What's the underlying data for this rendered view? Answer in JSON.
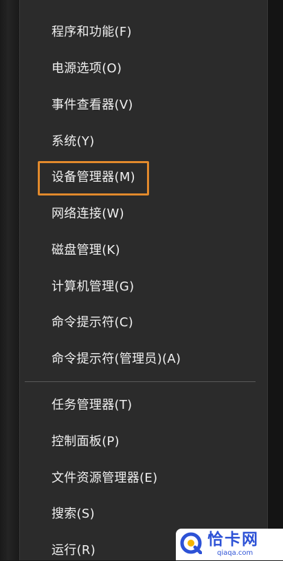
{
  "menu": {
    "items": [
      {
        "label": "程序和功能(F)"
      },
      {
        "label": "电源选项(O)"
      },
      {
        "label": "事件查看器(V)"
      },
      {
        "label": "系统(Y)"
      },
      {
        "label": "设备管理器(M)"
      },
      {
        "label": "网络连接(W)"
      },
      {
        "label": "磁盘管理(K)"
      },
      {
        "label": "计算机管理(G)"
      },
      {
        "label": "命令提示符(C)"
      },
      {
        "label": "命令提示符(管理员)(A)"
      },
      {
        "label": "任务管理器(T)"
      },
      {
        "label": "控制面板(P)"
      },
      {
        "label": "文件资源管理器(E)"
      },
      {
        "label": "搜索(S)"
      },
      {
        "label": "运行(R)"
      }
    ],
    "highlighted_item": "设备管理器(M)"
  },
  "colors": {
    "menu_background": "#2b2b2b",
    "text": "#f0f0f0",
    "highlight_border": "#e38a2c",
    "watermark_brand": "#2d52d6"
  },
  "watermark": {
    "title": "恰卡网",
    "url": "qiaqa.com"
  }
}
